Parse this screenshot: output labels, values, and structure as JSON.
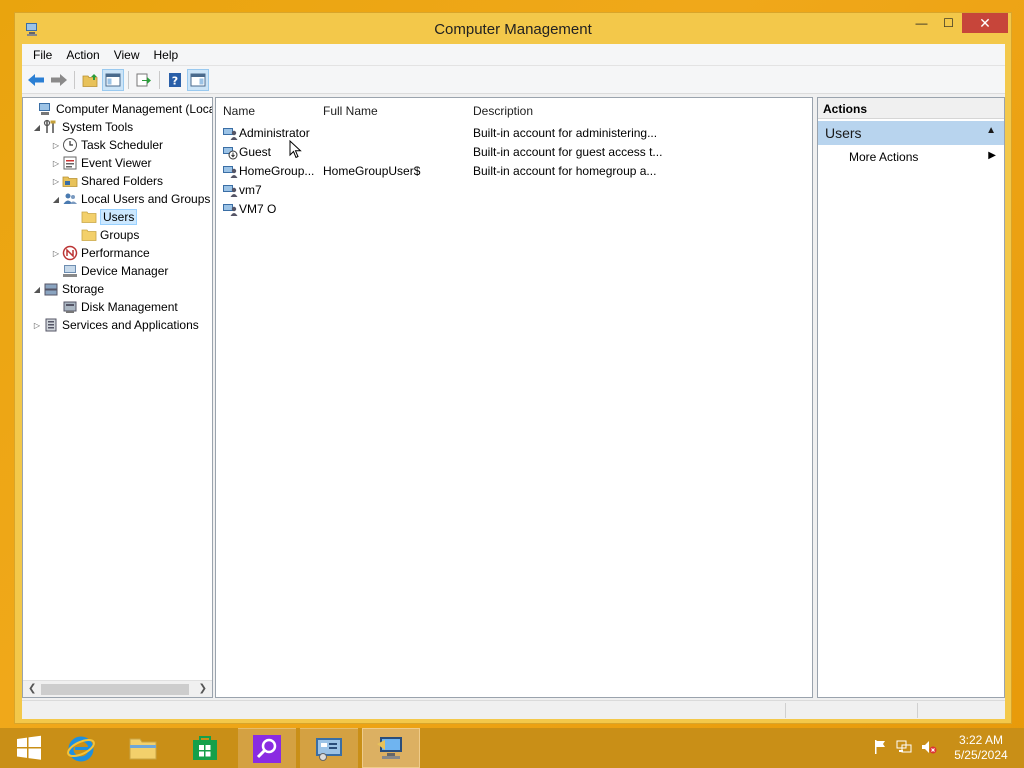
{
  "window": {
    "title": "Computer Management",
    "controls": {
      "minimize": "—",
      "maximize": "☐",
      "close": "✕"
    }
  },
  "menu": [
    "File",
    "Action",
    "View",
    "Help"
  ],
  "toolbar": {
    "buttons": [
      "back-icon",
      "forward-icon",
      "up-folder-icon",
      "show-hide-tree-icon",
      "export-list-icon",
      "help-icon",
      "show-hide-action-pane-icon"
    ]
  },
  "tree": {
    "items": [
      {
        "label": "Computer Management (Local",
        "level": 0,
        "expander": "",
        "icon": "computer-management-icon"
      },
      {
        "label": "System Tools",
        "level": 1,
        "expander": "◢",
        "icon": "system-tools-icon"
      },
      {
        "label": "Task Scheduler",
        "level": 2,
        "expander": "▷",
        "icon": "clock-icon"
      },
      {
        "label": "Event Viewer",
        "level": 2,
        "expander": "▷",
        "icon": "event-viewer-icon"
      },
      {
        "label": "Shared Folders",
        "level": 2,
        "expander": "▷",
        "icon": "shared-folders-icon"
      },
      {
        "label": "Local Users and Groups",
        "level": 2,
        "expander": "◢",
        "icon": "users-groups-icon"
      },
      {
        "label": "Users",
        "level": 3,
        "expander": "",
        "icon": "folder-icon",
        "selected": true
      },
      {
        "label": "Groups",
        "level": 3,
        "expander": "",
        "icon": "folder-icon"
      },
      {
        "label": "Performance",
        "level": 2,
        "expander": "▷",
        "icon": "performance-icon"
      },
      {
        "label": "Device Manager",
        "level": 2,
        "expander": "",
        "icon": "device-manager-icon"
      },
      {
        "label": "Storage",
        "level": 1,
        "expander": "◢",
        "icon": "storage-icon"
      },
      {
        "label": "Disk Management",
        "level": 2,
        "expander": "",
        "icon": "disk-management-icon"
      },
      {
        "label": "Services and Applications",
        "level": 1,
        "expander": "▷",
        "icon": "services-icon"
      }
    ]
  },
  "list": {
    "columns": {
      "name": "Name",
      "full_name": "Full Name",
      "description": "Description"
    },
    "rows": [
      {
        "name": "Administrator",
        "full_name": "",
        "description": "Built-in account for administering..."
      },
      {
        "name": "Guest",
        "full_name": "",
        "description": "Built-in account for guest access t..."
      },
      {
        "name": "HomeGroup...",
        "full_name": "HomeGroupUser$",
        "description": "Built-in account for homegroup a..."
      },
      {
        "name": "vm7",
        "full_name": "",
        "description": ""
      },
      {
        "name": "VM7 O",
        "full_name": "",
        "description": ""
      }
    ]
  },
  "actions": {
    "header": "Actions",
    "section": "Users",
    "items": [
      "More Actions"
    ]
  },
  "taskbar": {
    "apps": [
      "start-icon",
      "internet-explorer-icon",
      "file-explorer-icon",
      "store-icon",
      "search-app-icon",
      "control-panel-icon",
      "computer-management-app-icon"
    ],
    "tray_icons": [
      "flag-icon",
      "network-icon",
      "volume-muted-icon"
    ],
    "time": "3:22 AM",
    "date": "5/25/2024"
  },
  "colors": {
    "desktop": "#e9a40e",
    "window_frame": "#f3c84a",
    "close_button": "#c7453a",
    "section_highlight": "#b8d4ee",
    "taskbar": "#c98f17"
  }
}
